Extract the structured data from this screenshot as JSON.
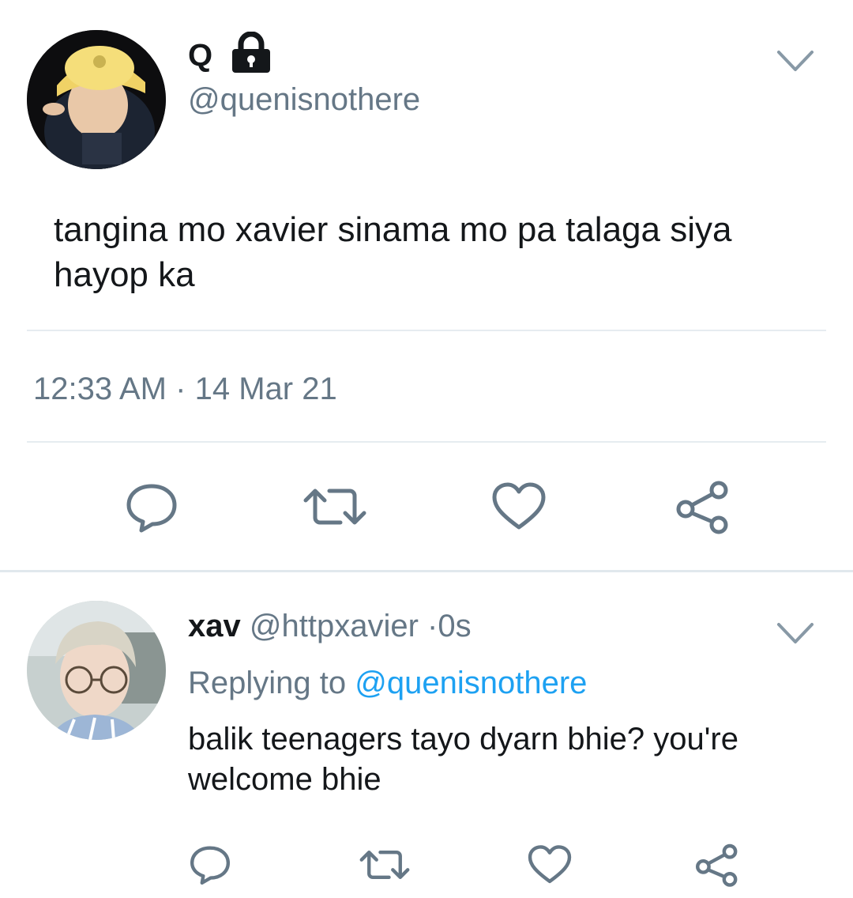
{
  "main_tweet": {
    "display_name": "Q",
    "handle": "@quenisnothere",
    "text": "tangina mo xavier sinama mo pa talaga siya hayop ka",
    "time": "12:33 AM",
    "separator": "·",
    "date": "14 Mar 21",
    "icons": {
      "lock": "lock-icon",
      "more": "chevron-down-icon",
      "reply": "reply-icon",
      "retweet": "retweet-icon",
      "like": "heart-icon",
      "share": "share-icon"
    }
  },
  "reply_tweet": {
    "display_name": "xav",
    "handle": "@httpxavier",
    "separator": "·",
    "time_ago": "0s",
    "replying_prefix": "Replying to",
    "replying_mention": "@quenisnothere",
    "text": "balik teenagers tayo dyarn bhie? you're welcome bhie"
  },
  "colors": {
    "text_primary": "#14171a",
    "text_secondary": "#657786",
    "link": "#1da1f2",
    "icon": "#657786",
    "divider": "#e6ecf0"
  }
}
